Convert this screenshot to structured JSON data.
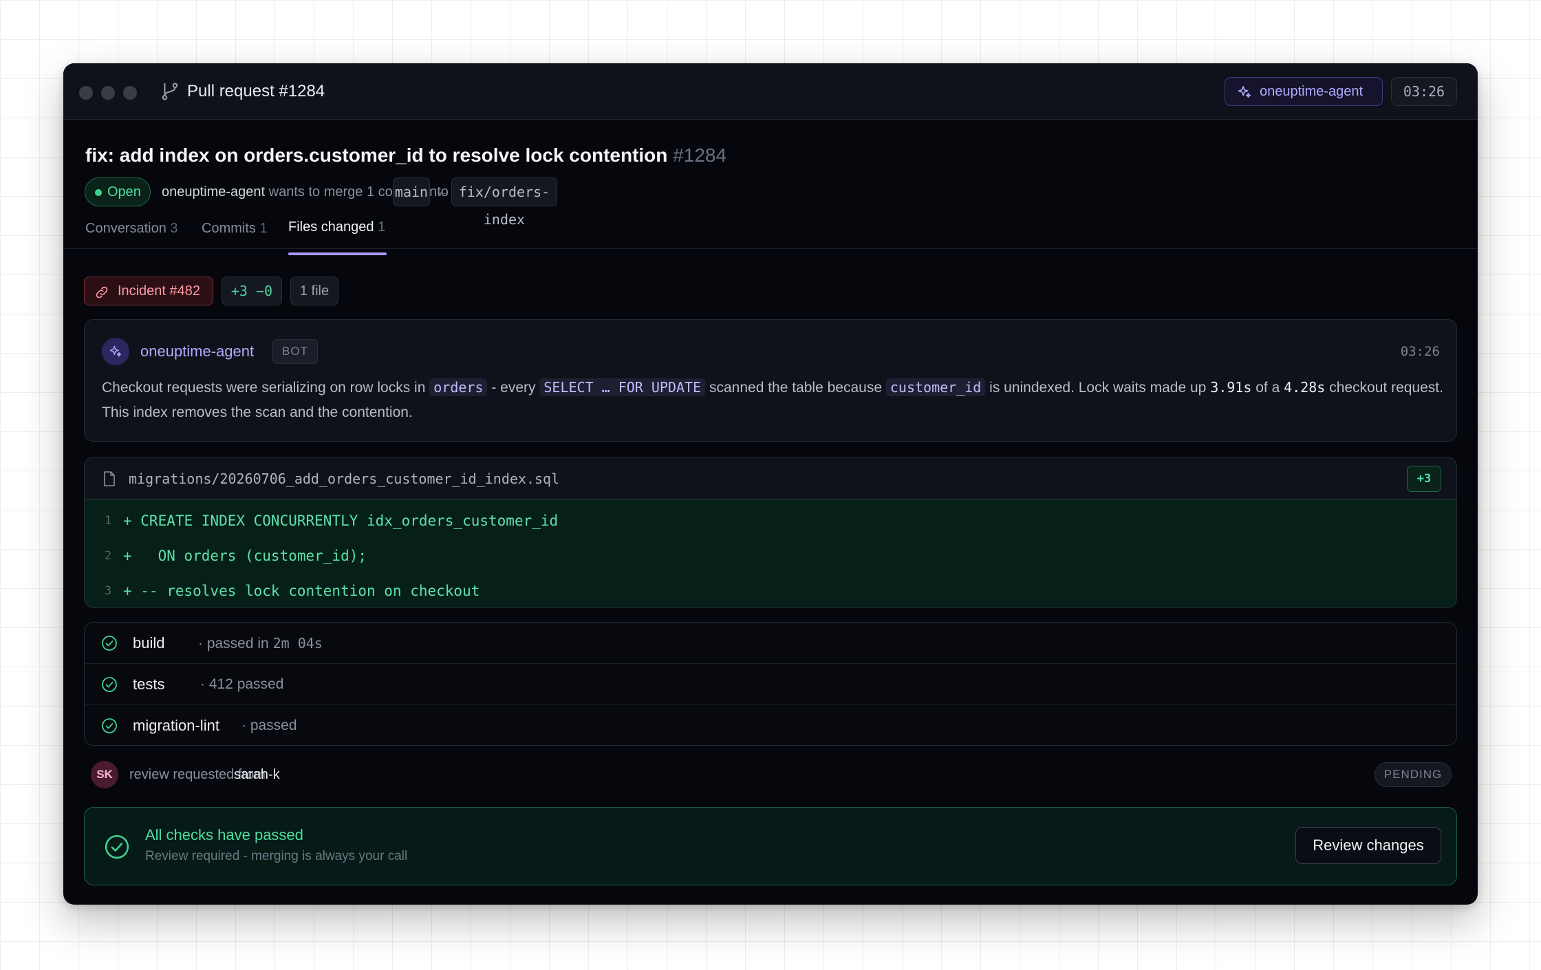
{
  "window": {
    "title": "Pull request #1284",
    "agent_name": "oneuptime-agent",
    "clock": "03:26"
  },
  "pr": {
    "title": "fix: add index on orders.customer_id to resolve lock contention",
    "number": "#1284",
    "status": "Open",
    "author": "oneuptime-agent",
    "merge_text": "wants to merge 1 commit into",
    "base_branch": "main",
    "arrow": "←",
    "head_branch": "fix/orders-index"
  },
  "tabs": [
    {
      "label": "Conversation",
      "count": "3"
    },
    {
      "label": "Commits",
      "count": "1"
    },
    {
      "label": "Files changed",
      "count": "1",
      "active": true
    }
  ],
  "chips": {
    "incident": "Incident #482",
    "diff": "+3 −0",
    "files": "1 file"
  },
  "comment": {
    "author": "oneuptime-agent",
    "badge": "BOT",
    "time": "03:26",
    "body": {
      "p1": "Checkout requests were serializing on row locks in",
      "c1": "orders",
      "p2": "- every",
      "c2": "SELECT … FOR UPDATE",
      "p3": "scanned the table because",
      "c3": "customer_id",
      "p4": "is unindexed. Lock waits made up",
      "n1": "3.91s",
      "p5": "of a",
      "n2": "4.28s",
      "p6": "checkout request. This index removes the scan and the contention."
    }
  },
  "file": {
    "path": "migrations/20260706_add_orders_customer_id_index.sql",
    "badge": "+3",
    "lines": [
      {
        "num": "1",
        "code": "+ CREATE INDEX CONCURRENTLY idx_orders_customer_id"
      },
      {
        "num": "2",
        "code": "+   ON orders (customer_id);"
      },
      {
        "num": "3",
        "code": "+ -- resolves lock contention on checkout"
      }
    ]
  },
  "checks": [
    {
      "name": "build",
      "detail": "· passed in",
      "detail_mono": "2m 04s"
    },
    {
      "name": "tests",
      "detail": "· 412 passed",
      "detail_mono": ""
    },
    {
      "name": "migration-lint",
      "detail": "· passed",
      "detail_mono": ""
    }
  ],
  "review": {
    "initials": "SK",
    "text": "review requested from",
    "user": "sarah-k",
    "status": "PENDING"
  },
  "merge": {
    "title": "All checks have passed",
    "subtitle": "Review required - merging is always your call",
    "button": "Review changes"
  },
  "colors": {
    "accent": "#a998ff",
    "success": "#4be0a0",
    "danger": "#ff9aa3",
    "window_bg": "#05070d"
  }
}
